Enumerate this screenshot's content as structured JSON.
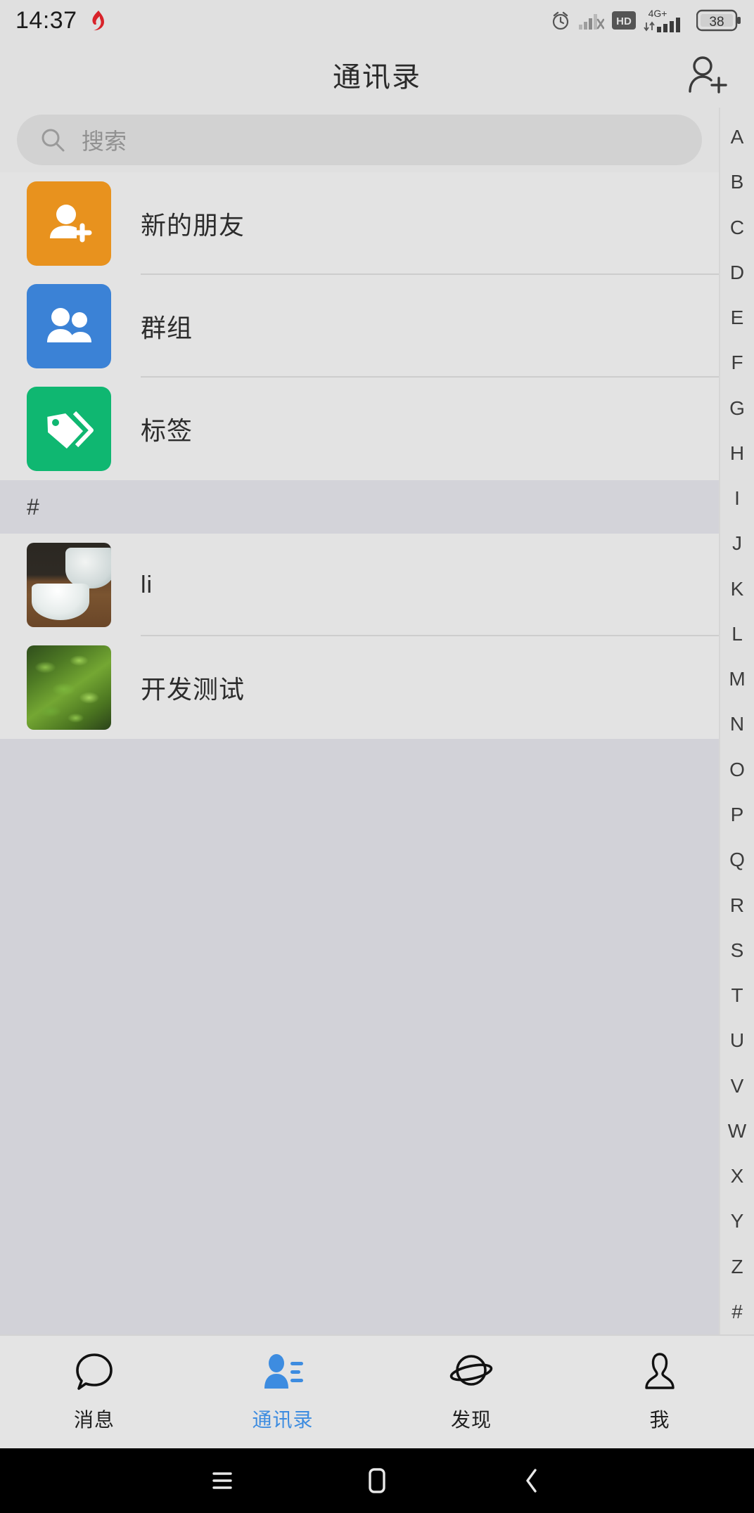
{
  "status_bar": {
    "time": "14:37",
    "notification_icon": "app-notification-icon",
    "icons": [
      "alarm-icon",
      "signal-no-service-icon",
      "hd-icon",
      "mobile-data-4gplus-icon"
    ],
    "network_label": "4G+",
    "hd_label": "HD",
    "battery_level": "38"
  },
  "header": {
    "title": "通讯录",
    "action_icon": "add-contact-icon"
  },
  "search": {
    "placeholder": "搜索",
    "icon": "search-icon",
    "value": ""
  },
  "entries": [
    {
      "label": "新的朋友",
      "icon": "new-friend-icon",
      "tile_color": "#e8921e",
      "type": "tile"
    },
    {
      "label": "群组",
      "icon": "group-icon",
      "tile_color": "#3b82d6",
      "type": "tile"
    },
    {
      "label": "标签",
      "icon": "tag-icon",
      "tile_color": "#0fb771",
      "type": "tile"
    }
  ],
  "sections": [
    {
      "letter": "#",
      "contacts": [
        {
          "name": "li",
          "avatar": "teacup-photo-avatar"
        },
        {
          "name": "开发测试",
          "avatar": "green-leaves-photo-avatar"
        }
      ]
    }
  ],
  "index_rail": [
    "A",
    "B",
    "C",
    "D",
    "E",
    "F",
    "G",
    "H",
    "I",
    "J",
    "K",
    "L",
    "M",
    "N",
    "O",
    "P",
    "Q",
    "R",
    "S",
    "T",
    "U",
    "V",
    "W",
    "X",
    "Y",
    "Z",
    "#"
  ],
  "tab_bar": {
    "active_color": "#3d8ce0",
    "tabs": [
      {
        "label": "消息",
        "icon": "chat-bubble-icon",
        "active": false
      },
      {
        "label": "通讯录",
        "icon": "contacts-icon",
        "active": true
      },
      {
        "label": "发现",
        "icon": "planet-icon",
        "active": false
      },
      {
        "label": "我",
        "icon": "person-icon",
        "active": false
      }
    ]
  },
  "nav_bar": {
    "buttons": [
      {
        "icon": "menu-icon"
      },
      {
        "icon": "home-icon"
      },
      {
        "icon": "back-icon"
      }
    ]
  }
}
